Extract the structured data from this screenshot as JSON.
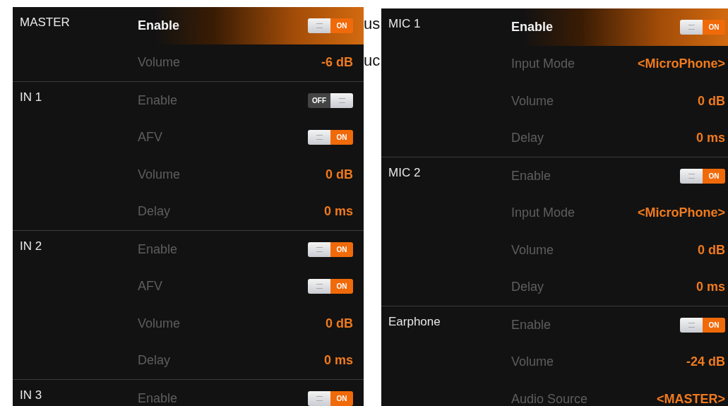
{
  "background_fragments": [
    "us",
    "uc"
  ],
  "panels": [
    {
      "sections": [
        {
          "name": "MASTER",
          "rows": [
            {
              "label": "Enable",
              "kind": "toggle",
              "on": true,
              "selected": true,
              "on_label": "ON"
            },
            {
              "label": "Volume",
              "kind": "value",
              "value": "-6 dB",
              "selected": false
            }
          ]
        },
        {
          "name": "IN 1",
          "rows": [
            {
              "label": "Enable",
              "kind": "toggle",
              "on": false,
              "selected": false,
              "off_label": "OFF"
            },
            {
              "label": "AFV",
              "kind": "toggle",
              "on": true,
              "selected": false,
              "on_label": "ON"
            },
            {
              "label": "Volume",
              "kind": "value",
              "value": "0 dB",
              "selected": false
            },
            {
              "label": "Delay",
              "kind": "value",
              "value": "0 ms",
              "selected": false
            }
          ]
        },
        {
          "name": "IN 2",
          "rows": [
            {
              "label": "Enable",
              "kind": "toggle",
              "on": true,
              "selected": false,
              "on_label": "ON"
            },
            {
              "label": "AFV",
              "kind": "toggle",
              "on": true,
              "selected": false,
              "on_label": "ON"
            },
            {
              "label": "Volume",
              "kind": "value",
              "value": "0 dB",
              "selected": false
            },
            {
              "label": "Delay",
              "kind": "value",
              "value": "0 ms",
              "selected": false
            }
          ]
        },
        {
          "name": "IN 3",
          "rows": [
            {
              "label": "Enable",
              "kind": "toggle",
              "on": true,
              "selected": false,
              "on_label": "ON"
            }
          ]
        }
      ]
    },
    {
      "sections": [
        {
          "name": "MIC 1",
          "rows": [
            {
              "label": "Enable",
              "kind": "toggle",
              "on": true,
              "selected": true,
              "on_label": "ON"
            },
            {
              "label": "Input Mode",
              "kind": "value",
              "value": "<MicroPhone>",
              "selected": false
            },
            {
              "label": "Volume",
              "kind": "value",
              "value": "0 dB",
              "selected": false
            },
            {
              "label": "Delay",
              "kind": "value",
              "value": "0 ms",
              "selected": false
            }
          ]
        },
        {
          "name": "MIC 2",
          "rows": [
            {
              "label": "Enable",
              "kind": "toggle",
              "on": true,
              "selected": false,
              "on_label": "ON"
            },
            {
              "label": "Input Mode",
              "kind": "value",
              "value": "<MicroPhone>",
              "selected": false
            },
            {
              "label": "Volume",
              "kind": "value",
              "value": "0 dB",
              "selected": false
            },
            {
              "label": "Delay",
              "kind": "value",
              "value": "0 ms",
              "selected": false
            }
          ]
        },
        {
          "name": "Earphone",
          "rows": [
            {
              "label": "Enable",
              "kind": "toggle",
              "on": true,
              "selected": false,
              "on_label": "ON"
            },
            {
              "label": "Volume",
              "kind": "value",
              "value": "-24 dB",
              "selected": false
            },
            {
              "label": "Audio Source",
              "kind": "value",
              "value": "<MASTER>",
              "selected": false
            }
          ]
        }
      ]
    }
  ]
}
